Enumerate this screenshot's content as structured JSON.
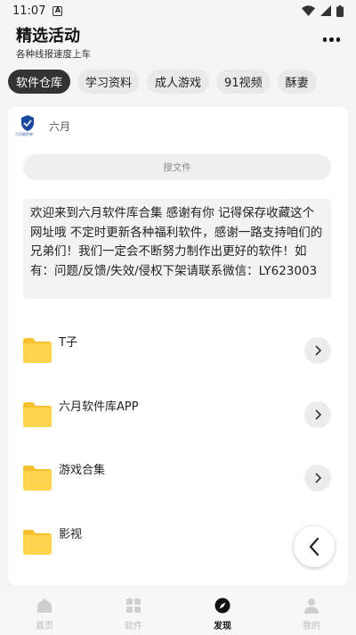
{
  "status": {
    "time": "11:07",
    "notif_letter": "A"
  },
  "header": {
    "title": "精选活动",
    "subtitle": "各种线报速度上车"
  },
  "tabs": [
    {
      "label": "软件仓库",
      "active": true
    },
    {
      "label": "学习资料",
      "active": false
    },
    {
      "label": "成人游戏",
      "active": false
    },
    {
      "label": "91视频",
      "active": false
    },
    {
      "label": "酥妻",
      "active": false
    }
  ],
  "card": {
    "name": "六月",
    "logo_text": "六月软件库",
    "search_placeholder": "搜文件",
    "notice": "欢迎来到六月软件库合集 感谢有你 记得保存收藏这个网址哦 不定时更新各种福利软件，感谢一路支持咱们的兄弟们！我们一定会不断努力制作出更好的软件！如有：问题/反馈/失效/侵权下架请联系微信：LY623003",
    "folders": [
      {
        "label": "T子"
      },
      {
        "label": "六月软件库APP"
      },
      {
        "label": "游戏合集"
      },
      {
        "label": "影视"
      }
    ]
  },
  "bottom_nav": [
    {
      "label": "首页",
      "icon": "home-icon",
      "active": false
    },
    {
      "label": "软件",
      "icon": "grid-icon",
      "active": false
    },
    {
      "label": "发现",
      "icon": "compass-icon",
      "active": true
    },
    {
      "label": "我的",
      "icon": "person-icon",
      "active": false
    }
  ],
  "colors": {
    "folder": "#ffd54f",
    "folder_tab": "#f7c12e",
    "active_tab": "#333333",
    "logo_blue": "#1b4a9c"
  }
}
